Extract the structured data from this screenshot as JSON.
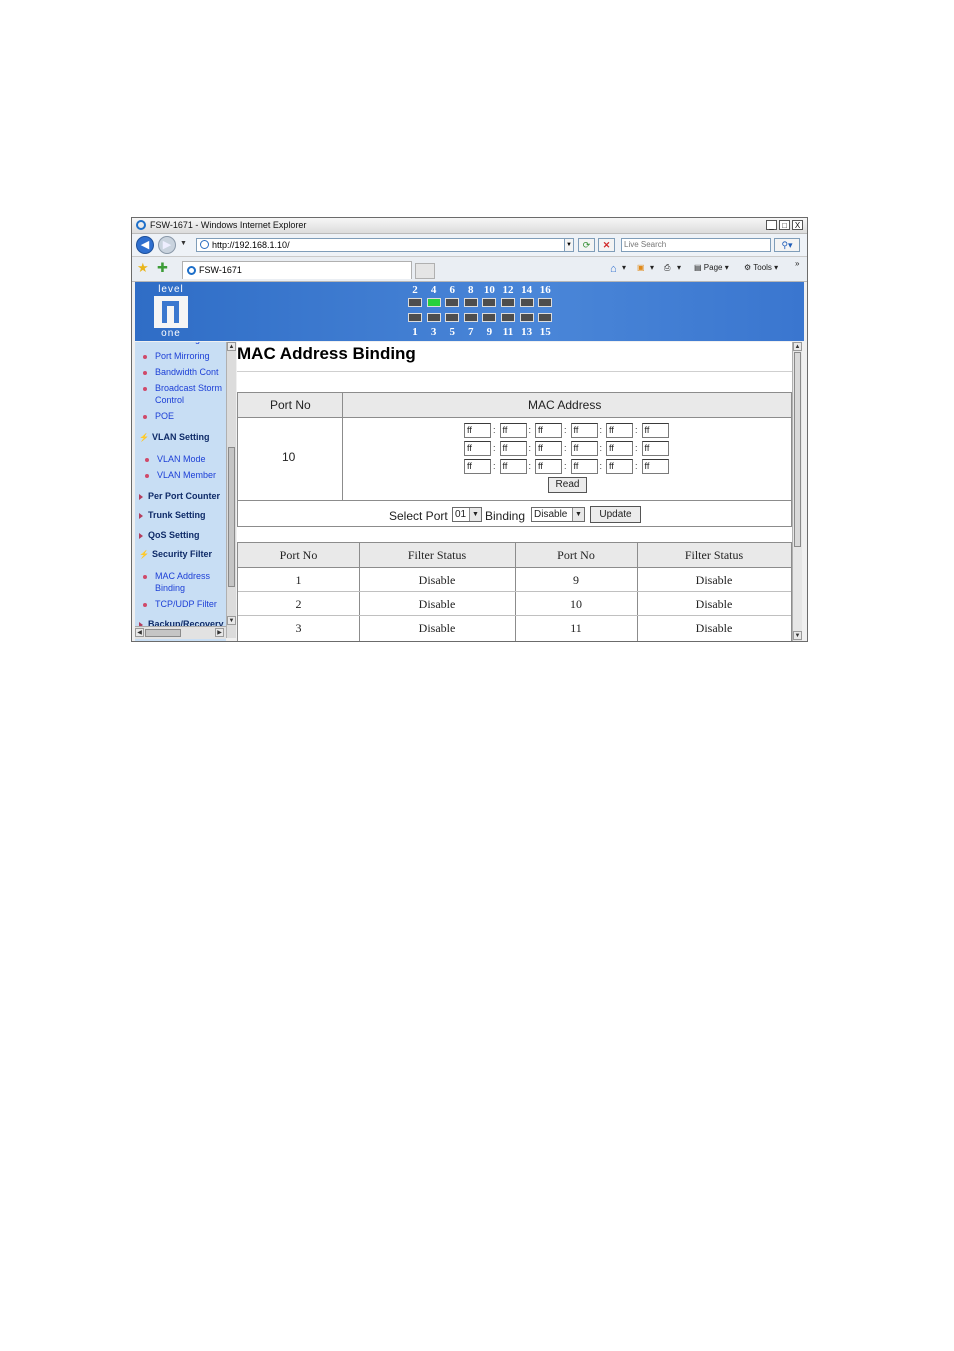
{
  "window": {
    "title": "FSW-1671 - Windows Internet Explorer",
    "controls": [
      "_",
      "□",
      "X"
    ]
  },
  "browser": {
    "address": "http://192.168.1.10/",
    "search_placeholder": "Live Search",
    "tab_title": "FSW-1671",
    "tools": {
      "page": "Page",
      "tools": "Tools"
    }
  },
  "banner": {
    "logo_top": "level",
    "logo_bottom": "one",
    "ports_top": [
      "2",
      "4",
      "6",
      "8",
      "10",
      "12",
      "14",
      "16"
    ],
    "ports_bottom": [
      "1",
      "3",
      "5",
      "7",
      "9",
      "11",
      "13",
      "15"
    ],
    "active_port": "4",
    "active_color": "#27d13b",
    "colors": {
      "banner": "#3a76cf",
      "sidebar": "#c8def4",
      "link": "#1c3fd6"
    }
  },
  "sidebar": {
    "items": [
      {
        "label": "Port Configuration",
        "type": "sub"
      },
      {
        "label": "Port Mirroring",
        "type": "sub"
      },
      {
        "label": "Bandwidth Cont",
        "type": "sub"
      },
      {
        "label": "Broadcast Storm",
        "type": "sub"
      },
      {
        "label": "Control",
        "type": "sub-cont"
      },
      {
        "label": "POE",
        "type": "sub"
      },
      {
        "label": "VLAN Setting",
        "type": "head-open"
      },
      {
        "label": "VLAN Mode",
        "type": "sub"
      },
      {
        "label": "VLAN Member",
        "type": "sub"
      },
      {
        "label": "Per Port Counter",
        "type": "head"
      },
      {
        "label": "Trunk Setting",
        "type": "head"
      },
      {
        "label": "QoS Setting",
        "type": "head"
      },
      {
        "label": "Security Filter",
        "type": "head-open"
      },
      {
        "label": "MAC Address",
        "type": "sub"
      },
      {
        "label": "Binding",
        "type": "sub-cont"
      },
      {
        "label": "TCP/UDP Filter",
        "type": "sub"
      },
      {
        "label": "Backup/Recovery",
        "type": "head"
      }
    ]
  },
  "page": {
    "title": "MAC Address Binding",
    "binding_table": {
      "col_port": "Port No",
      "col_mac": "MAC Address",
      "port_value": "10",
      "mac_rows": [
        [
          "ff",
          "ff",
          "ff",
          "ff",
          "ff",
          "ff"
        ],
        [
          "ff",
          "ff",
          "ff",
          "ff",
          "ff",
          "ff"
        ],
        [
          "ff",
          "ff",
          "ff",
          "ff",
          "ff",
          "ff"
        ]
      ],
      "read_label": "Read"
    },
    "controls": {
      "select_port_label": "Select Port",
      "select_port_value": "01",
      "binding_label": "Binding",
      "binding_value": "Disable",
      "update_label": "Update"
    },
    "status_table": {
      "headers": [
        "Port No",
        "Filter Status",
        "Port No",
        "Filter Status"
      ],
      "rows": [
        [
          "1",
          "Disable",
          "9",
          "Disable"
        ],
        [
          "2",
          "Disable",
          "10",
          "Disable"
        ],
        [
          "3",
          "Disable",
          "11",
          "Disable"
        ]
      ]
    }
  }
}
